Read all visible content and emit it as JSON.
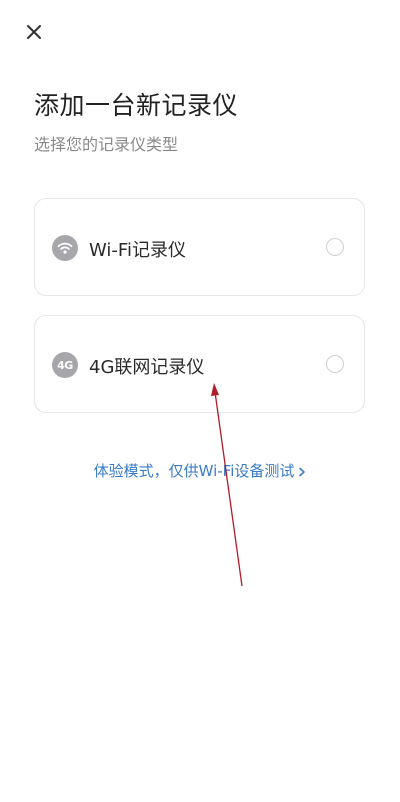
{
  "header": {
    "close_icon": "close-icon",
    "title": "添加一台新记录仪",
    "subtitle": "选择您的记录仪类型"
  },
  "options": [
    {
      "icon": "wifi-icon",
      "label": "Wi-Fi记录仪",
      "selected": false
    },
    {
      "icon": "4g-icon",
      "icon_text": "4G",
      "label": "4G联网记录仪",
      "selected": false
    }
  ],
  "demo": {
    "label": "体验模式，仅供Wi-Fi设备测试",
    "icon": "chevron-right-icon"
  },
  "colors": {
    "link": "#3a7bc8",
    "icon_bg": "#a6a6ab",
    "annotation_arrow": "#b01c2a"
  }
}
